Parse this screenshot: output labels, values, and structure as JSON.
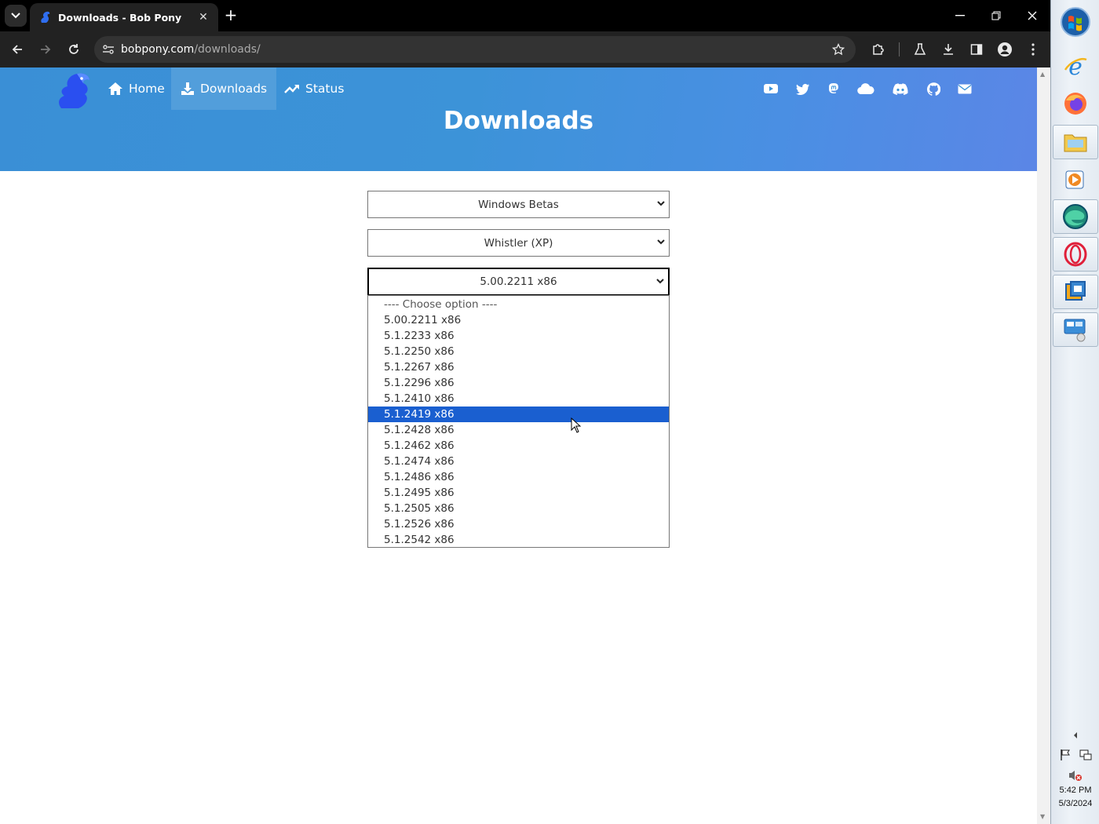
{
  "browser": {
    "tab_title": "Downloads - Bob Pony",
    "url_domain": "bobpony.com",
    "url_path": "/downloads/"
  },
  "nav": {
    "links": [
      {
        "label": "Home",
        "icon": "home-icon"
      },
      {
        "label": "Downloads",
        "icon": "download-icon"
      },
      {
        "label": "Status",
        "icon": "trending-up-icon"
      }
    ],
    "social_icons": [
      "youtube-icon",
      "twitter-icon",
      "mastodon-icon",
      "cloud-icon",
      "discord-icon",
      "github-icon",
      "email-icon"
    ]
  },
  "page": {
    "title": "Downloads"
  },
  "selects": {
    "category": "Windows Betas",
    "product": "Whistler (XP)",
    "build": "5.00.2211 x86"
  },
  "build_options": {
    "placeholder": "---- Choose option ----",
    "items": [
      "5.00.2211 x86",
      "5.1.2233 x86",
      "5.1.2250 x86",
      "5.1.2267 x86",
      "5.1.2296 x86",
      "5.1.2410 x86",
      "5.1.2419 x86",
      "5.1.2428 x86",
      "5.1.2462 x86",
      "5.1.2474 x86",
      "5.1.2486 x86",
      "5.1.2495 x86",
      "5.1.2505 x86",
      "5.1.2526 x86",
      "5.1.2542 x86"
    ],
    "highlighted": "5.1.2419 x86"
  },
  "taskbar": {
    "time": "5:42 PM",
    "date": "5/3/2024"
  },
  "colors": {
    "hero_blue": "#3c93d8",
    "highlight": "#1a5fd0"
  }
}
